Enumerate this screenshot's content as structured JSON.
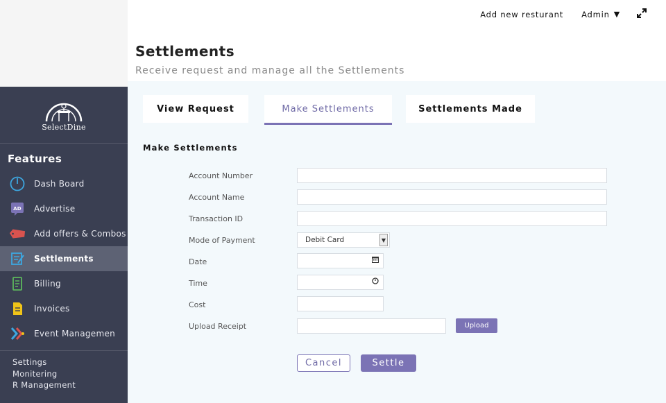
{
  "topbar": {
    "add_restaurant": "Add new resturant",
    "admin_label": "Admin",
    "admin_caret": "▼",
    "expand_icon": "expand-icon"
  },
  "header": {
    "title": "Settlements",
    "subtitle": "Receive request and manage all the Settlements"
  },
  "sidebar": {
    "logo_text": "SelectDine",
    "features_title": "Features",
    "items": [
      {
        "label": "Dash Board",
        "icon": "dashboard-icon"
      },
      {
        "label": "Advertise",
        "icon": "ad-icon"
      },
      {
        "label": "Add offers & Combos",
        "icon": "offer-tag-icon"
      },
      {
        "label": "Settlements",
        "icon": "settlement-icon",
        "active": true
      },
      {
        "label": "Billing",
        "icon": "billing-icon"
      },
      {
        "label": "Invoices",
        "icon": "invoice-icon"
      },
      {
        "label": "Event Managemen",
        "icon": "event-icon"
      }
    ],
    "bottom_links": [
      "Settings",
      "Monitering",
      "R Management"
    ]
  },
  "tabs": [
    {
      "label": "View Request"
    },
    {
      "label": "Make Settlements",
      "active": true
    },
    {
      "label": "Settlements Made"
    }
  ],
  "form": {
    "section_title": "Make Settlements",
    "account_number_label": "Account Number",
    "account_number_value": "",
    "account_name_label": "Account Name",
    "account_name_value": "",
    "transaction_id_label": "Transaction ID",
    "transaction_id_value": "",
    "payment_mode_label": "Mode of Payment",
    "payment_mode_value": "Debit Card",
    "date_label": "Date",
    "date_value": "",
    "time_label": "Time",
    "time_value": "",
    "cost_label": "Cost",
    "cost_value": "",
    "upload_receipt_label": "Upload Receipt",
    "upload_button": "Upload",
    "cancel_button": "Cancel",
    "settle_button": "Settle"
  },
  "colors": {
    "sidebar_bg": "#3a3f52",
    "sidebar_active": "#5d6274",
    "accent": "#7b73b5",
    "content_bg": "#f3f9fc"
  }
}
